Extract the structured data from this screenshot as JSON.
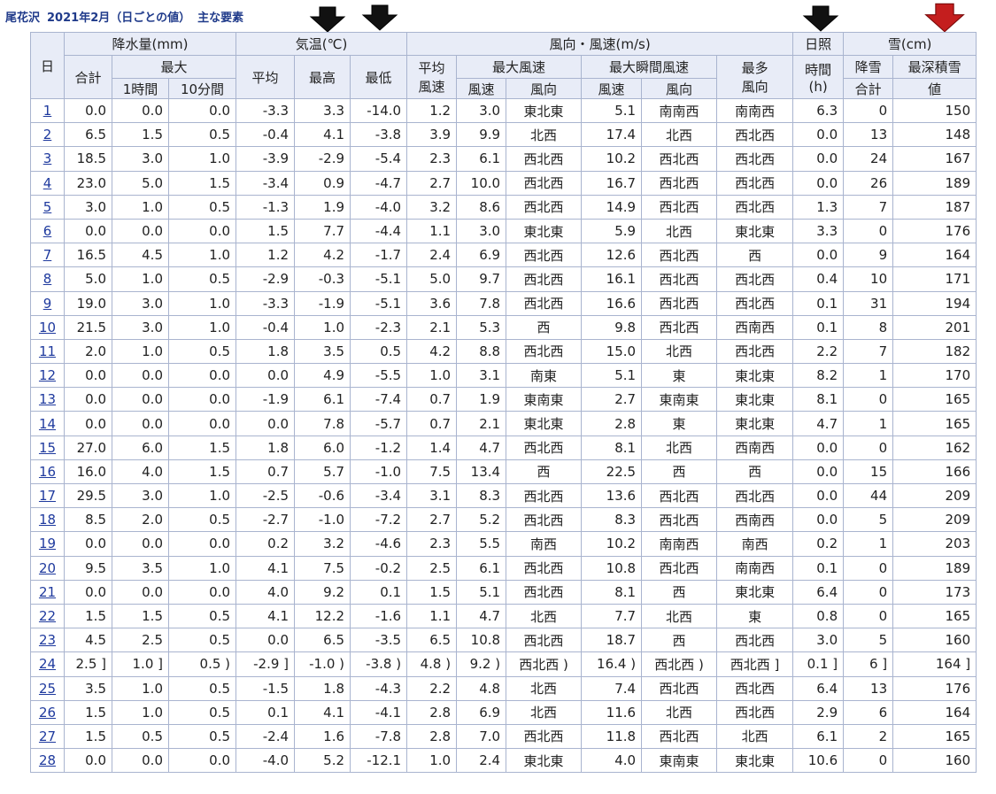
{
  "title": {
    "station": "尾花沢",
    "period": "2021年2月（日ごとの値）",
    "section": "主な要素"
  },
  "arrows": [
    {
      "name": "temp-high-arrow",
      "color": "#111111"
    },
    {
      "name": "temp-low-arrow",
      "color": "#111111"
    },
    {
      "name": "sunshine-arrow",
      "color": "#111111"
    },
    {
      "name": "snow-depth-arrow",
      "color": "#c41e1e"
    }
  ],
  "headers": {
    "day": "日",
    "precip_group": "降水量(mm)",
    "temp_group": "気温(℃)",
    "wind_group": "風向・風速(m/s)",
    "sun_group": "日照",
    "snow_group": "雪(cm)",
    "precip_total": "合計",
    "precip_max": "最大",
    "precip_1h": "1時間",
    "precip_10m": "10分間",
    "temp_avg": "平均",
    "temp_high": "最高",
    "temp_low": "最低",
    "wind_avg_a": "平均",
    "wind_avg_b": "風速",
    "wind_max": "最大風速",
    "wind_gust": "最大瞬間風速",
    "wind_mode_a": "最多",
    "wind_mode_b": "風向",
    "wind_speed": "風速",
    "wind_dir": "風向",
    "gust_speed": "風速",
    "gust_dir": "風向",
    "sun_time": "時間",
    "sun_unit": "(h)",
    "snowfall_a": "降雪",
    "snowfall_b": "合計",
    "snow_depth_a": "最深積雪",
    "snow_depth_b": "値"
  },
  "rows": [
    [
      "1",
      "0.0",
      "0.0",
      "0.0",
      "-3.3",
      "3.3",
      "-14.0",
      "1.2",
      "3.0",
      "東北東",
      "5.1",
      "南南西",
      "南南西",
      "6.3",
      "0",
      "150"
    ],
    [
      "2",
      "6.5",
      "1.5",
      "0.5",
      "-0.4",
      "4.1",
      "-3.8",
      "3.9",
      "9.9",
      "北西",
      "17.4",
      "北西",
      "西北西",
      "0.0",
      "13",
      "148"
    ],
    [
      "3",
      "18.5",
      "3.0",
      "1.0",
      "-3.9",
      "-2.9",
      "-5.4",
      "2.3",
      "6.1",
      "西北西",
      "10.2",
      "西北西",
      "西北西",
      "0.0",
      "24",
      "167"
    ],
    [
      "4",
      "23.0",
      "5.0",
      "1.5",
      "-3.4",
      "0.9",
      "-4.7",
      "2.7",
      "10.0",
      "西北西",
      "16.7",
      "西北西",
      "西北西",
      "0.0",
      "26",
      "189"
    ],
    [
      "5",
      "3.0",
      "1.0",
      "0.5",
      "-1.3",
      "1.9",
      "-4.0",
      "3.2",
      "8.6",
      "西北西",
      "14.9",
      "西北西",
      "西北西",
      "1.3",
      "7",
      "187"
    ],
    [
      "6",
      "0.0",
      "0.0",
      "0.0",
      "1.5",
      "7.7",
      "-4.4",
      "1.1",
      "3.0",
      "東北東",
      "5.9",
      "北西",
      "東北東",
      "3.3",
      "0",
      "176"
    ],
    [
      "7",
      "16.5",
      "4.5",
      "1.0",
      "1.2",
      "4.2",
      "-1.7",
      "2.4",
      "6.9",
      "西北西",
      "12.6",
      "西北西",
      "西",
      "0.0",
      "9",
      "164"
    ],
    [
      "8",
      "5.0",
      "1.0",
      "0.5",
      "-2.9",
      "-0.3",
      "-5.1",
      "5.0",
      "9.7",
      "西北西",
      "16.1",
      "西北西",
      "西北西",
      "0.4",
      "10",
      "171"
    ],
    [
      "9",
      "19.0",
      "3.0",
      "1.0",
      "-3.3",
      "-1.9",
      "-5.1",
      "3.6",
      "7.8",
      "西北西",
      "16.6",
      "西北西",
      "西北西",
      "0.1",
      "31",
      "194"
    ],
    [
      "10",
      "21.5",
      "3.0",
      "1.0",
      "-0.4",
      "1.0",
      "-2.3",
      "2.1",
      "5.3",
      "西",
      "9.8",
      "西北西",
      "西南西",
      "0.1",
      "8",
      "201"
    ],
    [
      "11",
      "2.0",
      "1.0",
      "0.5",
      "1.8",
      "3.5",
      "0.5",
      "4.2",
      "8.8",
      "西北西",
      "15.0",
      "北西",
      "西北西",
      "2.2",
      "7",
      "182"
    ],
    [
      "12",
      "0.0",
      "0.0",
      "0.0",
      "0.0",
      "4.9",
      "-5.5",
      "1.0",
      "3.1",
      "南東",
      "5.1",
      "東",
      "東北東",
      "8.2",
      "1",
      "170"
    ],
    [
      "13",
      "0.0",
      "0.0",
      "0.0",
      "-1.9",
      "6.1",
      "-7.4",
      "0.7",
      "1.9",
      "東南東",
      "2.7",
      "東南東",
      "東北東",
      "8.1",
      "0",
      "165"
    ],
    [
      "14",
      "0.0",
      "0.0",
      "0.0",
      "0.0",
      "7.8",
      "-5.7",
      "0.7",
      "2.1",
      "東北東",
      "2.8",
      "東",
      "東北東",
      "4.7",
      "1",
      "165"
    ],
    [
      "15",
      "27.0",
      "6.0",
      "1.5",
      "1.8",
      "6.0",
      "-1.2",
      "1.4",
      "4.7",
      "西北西",
      "8.1",
      "北西",
      "西南西",
      "0.0",
      "0",
      "162"
    ],
    [
      "16",
      "16.0",
      "4.0",
      "1.5",
      "0.7",
      "5.7",
      "-1.0",
      "7.5",
      "13.4",
      "西",
      "22.5",
      "西",
      "西",
      "0.0",
      "15",
      "166"
    ],
    [
      "17",
      "29.5",
      "3.0",
      "1.0",
      "-2.5",
      "-0.6",
      "-3.4",
      "3.1",
      "8.3",
      "西北西",
      "13.6",
      "西北西",
      "西北西",
      "0.0",
      "44",
      "209"
    ],
    [
      "18",
      "8.5",
      "2.0",
      "0.5",
      "-2.7",
      "-1.0",
      "-7.2",
      "2.7",
      "5.2",
      "西北西",
      "8.3",
      "西北西",
      "西南西",
      "0.0",
      "5",
      "209"
    ],
    [
      "19",
      "0.0",
      "0.0",
      "0.0",
      "0.2",
      "3.2",
      "-4.6",
      "2.3",
      "5.5",
      "南西",
      "10.2",
      "南南西",
      "南西",
      "0.2",
      "1",
      "203"
    ],
    [
      "20",
      "9.5",
      "3.5",
      "1.0",
      "4.1",
      "7.5",
      "-0.2",
      "2.5",
      "6.1",
      "西北西",
      "10.8",
      "西北西",
      "南南西",
      "0.1",
      "0",
      "189"
    ],
    [
      "21",
      "0.0",
      "0.0",
      "0.0",
      "4.0",
      "9.2",
      "0.1",
      "1.5",
      "5.1",
      "西北西",
      "8.1",
      "西",
      "東北東",
      "6.4",
      "0",
      "173"
    ],
    [
      "22",
      "1.5",
      "1.5",
      "0.5",
      "4.1",
      "12.2",
      "-1.6",
      "1.1",
      "4.7",
      "北西",
      "7.7",
      "北西",
      "東",
      "0.8",
      "0",
      "165"
    ],
    [
      "23",
      "4.5",
      "2.5",
      "0.5",
      "0.0",
      "6.5",
      "-3.5",
      "6.5",
      "10.8",
      "西北西",
      "18.7",
      "西",
      "西北西",
      "3.0",
      "5",
      "160"
    ],
    [
      "24",
      "2.5 ]",
      "1.0 ]",
      "0.5 )",
      "-2.9 ]",
      "-1.0 )",
      "-3.8 )",
      "4.8 )",
      "9.2 )",
      "西北西 )",
      "16.4 )",
      "西北西 )",
      "西北西 ]",
      "0.1 ]",
      "6 ]",
      "164 ]"
    ],
    [
      "25",
      "3.5",
      "1.0",
      "0.5",
      "-1.5",
      "1.8",
      "-4.3",
      "2.2",
      "4.8",
      "北西",
      "7.4",
      "西北西",
      "西北西",
      "6.4",
      "13",
      "176"
    ],
    [
      "26",
      "1.5",
      "1.0",
      "0.5",
      "0.1",
      "4.1",
      "-4.1",
      "2.8",
      "6.9",
      "北西",
      "11.6",
      "北西",
      "西北西",
      "2.9",
      "6",
      "164"
    ],
    [
      "27",
      "1.5",
      "0.5",
      "0.5",
      "-2.4",
      "1.6",
      "-7.8",
      "2.8",
      "7.0",
      "西北西",
      "11.8",
      "西北西",
      "北西",
      "6.1",
      "2",
      "165"
    ],
    [
      "28",
      "0.0",
      "0.0",
      "0.0",
      "-4.0",
      "5.2",
      "-12.1",
      "1.0",
      "2.4",
      "東北東",
      "4.0",
      "東南東",
      "東北東",
      "10.6",
      "0",
      "160"
    ]
  ]
}
